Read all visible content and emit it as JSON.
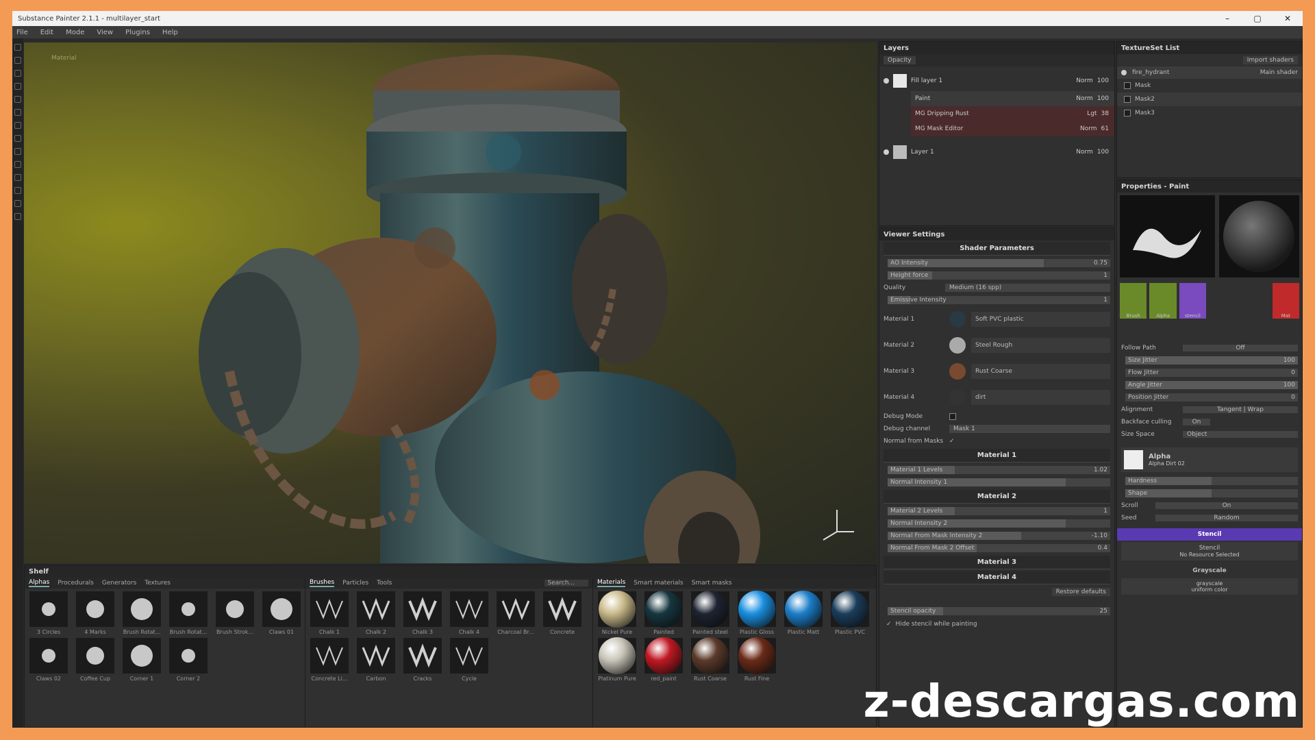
{
  "window": {
    "title": "Substance Painter 2.1.1 - multilayer_start",
    "minimize": "–",
    "maximize": "▢",
    "close": "✕"
  },
  "menu": [
    "File",
    "Edit",
    "Mode",
    "View",
    "Plugins",
    "Help"
  ],
  "viewport": {
    "label": "Material"
  },
  "layers": {
    "title": "Layers",
    "opacity": "Opacity",
    "items": [
      {
        "name": "Fill layer 1",
        "blend": "Norm",
        "value": "100"
      },
      {
        "name": "Paint",
        "blend": "Norm",
        "value": "100"
      },
      {
        "name": "MG Dripping Rust",
        "blend": "Lgt",
        "value": "38"
      },
      {
        "name": "MG Mask Editor",
        "blend": "Norm",
        "value": "61"
      },
      {
        "name": "Layer 1",
        "blend": "Norm",
        "value": "100"
      }
    ]
  },
  "texture_set": {
    "title": "TextureSet List",
    "import": "Import shaders",
    "main": "Main shader",
    "items": [
      "fire_hydrant",
      "Mask",
      "Mask2",
      "Mask3"
    ]
  },
  "viewer": {
    "title": "Viewer Settings",
    "shader_params": "Shader Parameters",
    "rows": [
      {
        "label": "AO Intensity",
        "value": "0.75"
      },
      {
        "label": "Height force",
        "value": "1"
      },
      {
        "label": "Quality",
        "value": "Medium (16 spp)"
      },
      {
        "label": "Emissive Intensity",
        "value": "1"
      }
    ],
    "materials": [
      {
        "label": "Material 1",
        "name": "Soft PVC plastic"
      },
      {
        "label": "Material 2",
        "name": "Steel Rough"
      },
      {
        "label": "Material 3",
        "name": "Rust Coarse"
      },
      {
        "label": "Material 4",
        "name": "dirt"
      }
    ],
    "debug_mode": "Debug Mode",
    "debug_channel": "Debug channel",
    "debug_channel_value": "Mask 1",
    "normal_from_masks": "Normal from Masks",
    "material1": "Material 1",
    "m1_rows": [
      {
        "label": "Material 1 Levels",
        "value": "1.02"
      },
      {
        "label": "Normal Intensity 1",
        "value": ""
      }
    ],
    "material2": "Material 2",
    "m2_rows": [
      {
        "label": "Material 2 Levels",
        "value": "1"
      },
      {
        "label": "Normal Intensity 2",
        "value": ""
      },
      {
        "label": "Normal From Mask Intensity 2",
        "value": "-1.10"
      },
      {
        "label": "Normal From Mask 2 Offset",
        "value": "0.4"
      }
    ],
    "material3": "Material 3",
    "material4": "Material 4",
    "restore": "Restore defaults",
    "stencil_opacity": "Stencil opacity",
    "stencil_opacity_value": "25",
    "hide_stencil": "Hide stencil while painting"
  },
  "properties": {
    "title": "Properties - Paint",
    "slots": [
      "Brush",
      "Alpha",
      "stencil",
      "Mat"
    ],
    "rows": [
      {
        "label": "Follow Path",
        "value": "Off"
      },
      {
        "label": "Size Jitter",
        "value": "100"
      },
      {
        "label": "Flow Jitter",
        "value": "0"
      },
      {
        "label": "Angle Jitter",
        "value": "100"
      },
      {
        "label": "Position Jitter",
        "value": "0"
      },
      {
        "label": "Alignment",
        "value": "Tangent | Wrap"
      },
      {
        "label": "Backface culling",
        "value": "On"
      },
      {
        "label": "Size Space",
        "value": "Object"
      }
    ],
    "alpha_title": "Alpha",
    "alpha_name": "Alpha Dirt 02",
    "hardness": "Hardness",
    "shape": "Shape",
    "scroll": "Scroll",
    "scroll_value": "On",
    "seed": "Seed",
    "seed_value": "Random",
    "stencil": "Stencil",
    "stencil_sub": "Stencil",
    "no_resource": "No Resource Selected",
    "grayscale": "Grayscale",
    "grayscale_sub": "grayscale",
    "uniform": "uniform color"
  },
  "shelf": {
    "title": "Shelf",
    "alpha_tabs": [
      "Alphas",
      "Procedurals",
      "Generators",
      "Textures"
    ],
    "alphas": [
      "3 Circles",
      "4 Marks",
      "Brush Rotat...",
      "Brush Rotat...",
      "Brush Strok...",
      "Claws 01",
      "Claws 02",
      "Coffee Cup",
      "Corner 1",
      "Corner 2"
    ],
    "brush_tabs": [
      "Brushes",
      "Particles",
      "Tools"
    ],
    "search": "Search...",
    "brushes": [
      "Chalk 1",
      "Chalk 2",
      "Chalk 3",
      "Chalk 4",
      "Charcoal Br...",
      "Concrete",
      "Concrete Li...",
      "Carbon",
      "Cracks",
      "Cycle"
    ],
    "mat_tabs": [
      "Materials",
      "Smart materials",
      "Smart masks"
    ],
    "materials": [
      {
        "name": "Nickel Pure",
        "color": "#c9b98a"
      },
      {
        "name": "Painted",
        "color": "#16363f"
      },
      {
        "name": "Painted steel",
        "color": "#1d2330"
      },
      {
        "name": "Plastic Gloss",
        "color": "#1a8fe0"
      },
      {
        "name": "Plastic Matt",
        "color": "#1c7ec9"
      },
      {
        "name": "Plastic PVC",
        "color": "#1a3d5a"
      },
      {
        "name": "Platinum Pure",
        "color": "#c8c4b8"
      },
      {
        "name": "red_paint",
        "color": "#c01822"
      },
      {
        "name": "Rust Coarse",
        "color": "#5a3a2a"
      },
      {
        "name": "Rust Fine",
        "color": "#6a2a18"
      }
    ]
  },
  "watermark": "z-descargas.com"
}
